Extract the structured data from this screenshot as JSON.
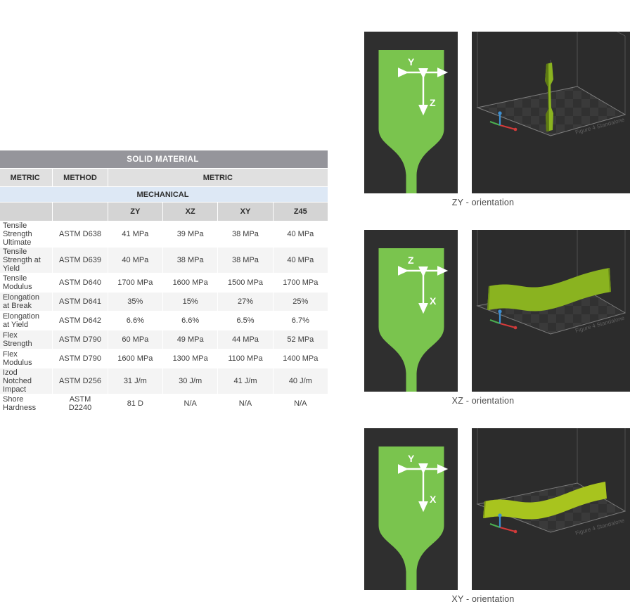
{
  "table": {
    "title": "SOLID MATERIAL",
    "unit_row": {
      "metric": "METRIC",
      "method": "METHOD",
      "units": "METRIC"
    },
    "section": "MECHANICAL",
    "columns": [
      "ZY",
      "XZ",
      "XY",
      "Z45"
    ],
    "rows": [
      {
        "metric": "Tensile Strength Ultimate",
        "method": "ASTM D638",
        "values": [
          "41 MPa",
          "39 MPa",
          "38 MPa",
          "40 MPa"
        ]
      },
      {
        "metric": "Tensile Strength at Yield",
        "method": "ASTM D639",
        "values": [
          "40 MPa",
          "38 MPa",
          "38 MPa",
          "40 MPa"
        ]
      },
      {
        "metric": "Tensile Modulus",
        "method": "ASTM D640",
        "values": [
          "1700 MPa",
          "1600 MPa",
          "1500 MPa",
          "1700 MPa"
        ]
      },
      {
        "metric": "Elongation at Break",
        "method": "ASTM D641",
        "values": [
          "35%",
          "15%",
          "27%",
          "25%"
        ]
      },
      {
        "metric": "Elongation at Yield",
        "method": "ASTM D642",
        "values": [
          "6.6%",
          "6.6%",
          "6.5%",
          "6.7%"
        ]
      },
      {
        "metric": "Flex Strength",
        "method": "ASTM D790",
        "values": [
          "60 MPa",
          "49 MPa",
          "44 MPa",
          "52 MPa"
        ]
      },
      {
        "metric": "Flex Modulus",
        "method": "ASTM D790",
        "values": [
          "1600 MPa",
          "1300 MPa",
          "1100 MPa",
          "1400 MPa"
        ]
      },
      {
        "metric": "Izod Notched Impact",
        "method": "ASTM D256",
        "values": [
          "31 J/m",
          "30 J/m",
          "41 J/m",
          "40 J/m"
        ]
      },
      {
        "metric": "Shore Hardness",
        "method": "ASTM D2240",
        "values": [
          "81 D",
          "N/A",
          "N/A",
          "N/A"
        ]
      }
    ],
    "colors": {
      "title_bg": "#95959b",
      "unit_bg": "#e0e0e0",
      "section_bg": "#dde8f5",
      "colhead_bg": "#d4d4d4",
      "row_alt_bg": "#f4f4f4"
    }
  },
  "figures": [
    {
      "caption": "ZY - orientation",
      "vertical_axis": "Z",
      "horizontal_axis": "Y",
      "part_pose": "upright",
      "watermark": "Figure 4 Standalone"
    },
    {
      "caption": "XZ - orientation",
      "vertical_axis": "X",
      "horizontal_axis": "Z",
      "part_pose": "on-edge",
      "watermark": "Figure 4 Standalone"
    },
    {
      "caption": "XY - orientation",
      "vertical_axis": "X",
      "horizontal_axis": "Y",
      "part_pose": "flat",
      "watermark": "Figure 4 Standalone"
    }
  ],
  "colors": {
    "silhouette_green": "#7ac44e",
    "part_olive": "#8ab320",
    "panel_dark": "#2f2f2f",
    "viewport_dark": "#2c2c2c"
  }
}
